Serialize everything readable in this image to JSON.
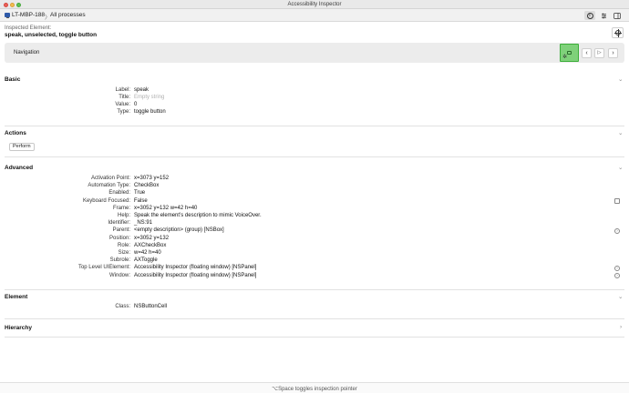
{
  "window": {
    "title": "Accessibility Inspector"
  },
  "toolbar": {
    "device": "LT-MBP-188",
    "separator": "〉",
    "process": "All processes",
    "buttons": [
      {
        "name": "info-icon"
      },
      {
        "name": "settings-icon"
      },
      {
        "name": "sidebar-icon"
      }
    ]
  },
  "inspected": {
    "label": "Inspected Element:",
    "value": "speak, unselected, toggle button"
  },
  "navigation": {
    "label": "Navigation"
  },
  "sections": {
    "basic": {
      "title": "Basic",
      "rows": [
        {
          "key": "Label:",
          "value": "speak"
        },
        {
          "key": "Title:",
          "value": "Empty string"
        },
        {
          "key": "Value:",
          "value": "0"
        },
        {
          "key": "Type:",
          "value": "toggle button"
        }
      ]
    },
    "actions": {
      "title": "Actions",
      "perform_label": "Perform"
    },
    "advanced": {
      "title": "Advanced",
      "rows": [
        {
          "key": "Activation Point:",
          "value": "x=3073 y=152"
        },
        {
          "key": "Automation Type:",
          "value": "CheckBox"
        },
        {
          "key": "Enabled:",
          "value": "True"
        },
        {
          "key": "Keyboard Focused:",
          "value": "False"
        },
        {
          "key": "Frame:",
          "value": "x=3052 y=132 w=42 h=40"
        },
        {
          "key": "Help:",
          "value": "Speak the element’s description to mimic VoiceOver."
        },
        {
          "key": "Identifier:",
          "value": "_NS:91"
        },
        {
          "key": "Parent:",
          "value": "<empty description> (group) [NSBox]"
        },
        {
          "key": "Position:",
          "value": "x=3052 y=132"
        },
        {
          "key": "Role:",
          "value": "AXCheckBox"
        },
        {
          "key": "Size:",
          "value": "w=42 h=40"
        },
        {
          "key": "Subrole:",
          "value": "AXToggle"
        },
        {
          "key": "Top Level UIElement:",
          "value": "Accessibility Inspector (floating window) [NSPanel]"
        },
        {
          "key": "Window:",
          "value": "Accessibility Inspector (floating window) [NSPanel]"
        }
      ]
    },
    "element": {
      "title": "Element",
      "rows": [
        {
          "key": "Class:",
          "value": "NSButtonCell"
        }
      ]
    },
    "hierarchy": {
      "title": "Hierarchy"
    }
  },
  "status": {
    "text": "⌥Space toggles inspection pointer"
  }
}
